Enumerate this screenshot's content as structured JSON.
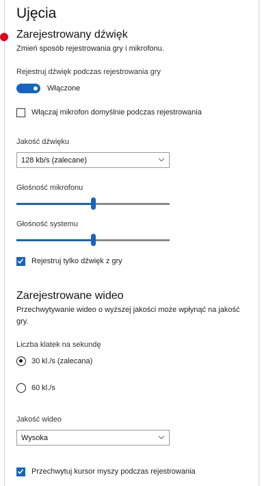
{
  "page": {
    "title": "Ujęcia"
  },
  "audio": {
    "heading": "Zarejestrowany dźwięk",
    "description": "Zmień sposób rejestrowania gry i mikrofonu.",
    "record_audio_label": "Rejestruj dźwięk podczas rejestrowania gry",
    "record_audio_toggle": {
      "state": "on",
      "state_label": "Włączone"
    },
    "mic_default": {
      "label": "Włączaj mikrofon domyślnie podczas rejestrowania",
      "checked": false
    },
    "quality": {
      "label": "Jakość dźwięku",
      "value": "128 kb/s (zalecane)"
    },
    "mic_volume": {
      "label": "Głośność mikrofonu",
      "level": 0.5
    },
    "system_volume": {
      "label": "Głośność systemu",
      "level": 0.5
    },
    "game_audio_only": {
      "label": "Rejestruj tylko dźwięk z gry",
      "checked": true
    }
  },
  "video": {
    "heading": "Zarejestrowane wideo",
    "description_line1": "Przechwytywanie wideo o wyższej jakości może wpłynąć na jakość",
    "description_line2": "gry.",
    "fps_label": "Liczba klatek na sekundę",
    "fps_options": [
      {
        "label": "30 kl./s (zalecana)",
        "selected": true
      },
      {
        "label": "60 kl./s",
        "selected": false
      }
    ],
    "quality": {
      "label": "Jakość wideo",
      "value": "Wysoka"
    },
    "capture_cursor": {
      "label": "Przechwytuj kursor myszy podczas rejestrowania",
      "checked": true
    }
  },
  "colors": {
    "accent": "#1565c0",
    "marker": "#e0001b"
  }
}
